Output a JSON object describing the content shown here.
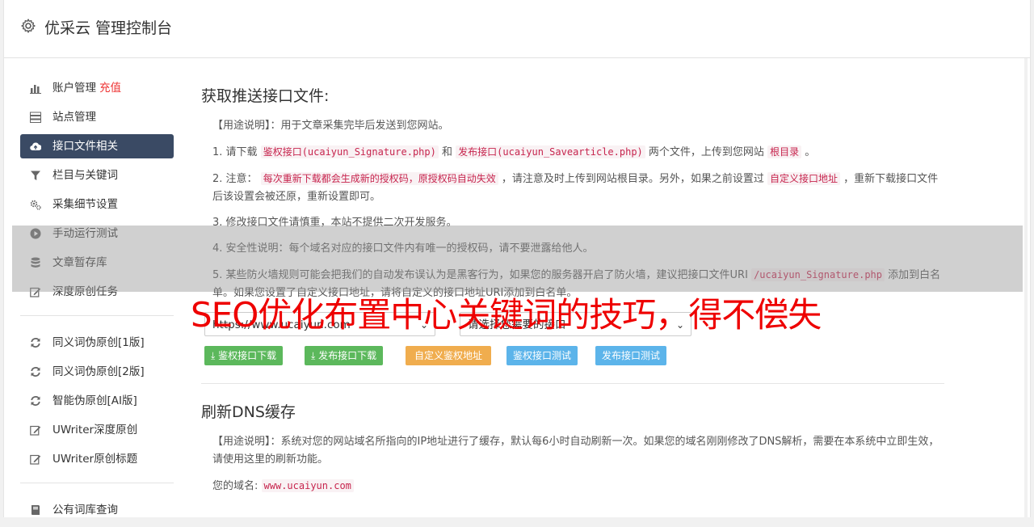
{
  "header": {
    "title": "优采云 管理控制台"
  },
  "sidebar": {
    "items": [
      {
        "label": "账户管理",
        "highlight": "充值",
        "icon": "bar-chart-icon"
      },
      {
        "label": "站点管理",
        "icon": "server-icon"
      },
      {
        "label": "接口文件相关",
        "icon": "cloud-upload-icon",
        "active": true
      },
      {
        "label": "栏目与关键词",
        "icon": "filter-icon"
      },
      {
        "label": "采集细节设置",
        "icon": "cogs-icon"
      },
      {
        "label": "手动运行测试",
        "icon": "play-circle-icon"
      },
      {
        "label": "文章暂存库",
        "icon": "database-icon"
      },
      {
        "label": "深度原创任务",
        "icon": "edit-icon"
      }
    ],
    "items2": [
      {
        "label": "同义词伪原创[1版]",
        "icon": "refresh-icon"
      },
      {
        "label": "同义词伪原创[2版]",
        "icon": "refresh-icon"
      },
      {
        "label": "智能伪原创[AI版]",
        "icon": "refresh-icon"
      },
      {
        "label": "UWriter深度原创",
        "icon": "edit-icon"
      },
      {
        "label": "UWriter原创标题",
        "icon": "edit-icon"
      }
    ],
    "items3": [
      {
        "label": "公有词库查询",
        "icon": "book-icon"
      }
    ]
  },
  "section1": {
    "title": "获取推送接口文件:",
    "usage": "【用途说明】：用于文章采集完毕后发送到您网站。",
    "step1_a": "1. 请下载",
    "step1_code1": "鉴权接口(ucaiyun_Signature.php)",
    "step1_b": "和",
    "step1_code2": "发布接口(ucaiyun_Savearticle.php)",
    "step1_c": "两个文件，上传到您网站",
    "step1_code3": "根目录",
    "step1_d": "。",
    "step2_a": "2. 注意：",
    "step2_code1": "每次重新下载都会生成新的授权码，原授权码自动失效",
    "step2_b": "，请注意及时上传到网站根目录。另外，如果之前设置过",
    "step2_code2": "自定义接口地址",
    "step2_c": "，重新下载接口文件后该设置会被还原，重新设置即可。",
    "step3": "3. 修改接口文件请慎重，本站不提供二次开发服务。",
    "step4": "4. 安全性说明：每个域名对应的接口文件内有唯一的授权码，请不要泄露给他人。",
    "step5_a": "5. 某些防火墙规则可能会把我们的自动发布误认为是黑客行为，如果您的服务器开启了防火墙，建议把接口文件URI",
    "step5_code": "/ucaiyun_Signature.php",
    "step5_b": "添加到白名单。如果您设置了自定义接口地址，请将自定义的接口地址URI添加到白名单。",
    "select_site": "https://www.ucaiyun.com",
    "select_api": "请选择您需要的接口",
    "btn_sign_download": "鉴权接口下载",
    "btn_publish_download": "发布接口下载",
    "btn_custom_sign": "自定义鉴权地址",
    "btn_sign_test": "鉴权接口测试",
    "btn_publish_test": "发布接口测试"
  },
  "section2": {
    "title": "刷新DNS缓存",
    "usage": "【用途说明】：系统对您的网站域名所指向的IP地址进行了缓存，默认每6小时自动刷新一次。如果您的域名刚刚修改了DNS解析，需要在本系统中立即生效，请使用这里的刷新功能。",
    "domain_label": "您的域名:",
    "domain_value": "www.ucaiyun.com"
  },
  "overlay": {
    "text": "SEO优化布置中心关键词的技巧，得不偿失"
  },
  "colors": {
    "active_nav": "#3a4a64",
    "green": "#5cb85c",
    "orange": "#f0ad4e",
    "blue": "#5cb4ea",
    "overlay_text": "#ee0000"
  }
}
